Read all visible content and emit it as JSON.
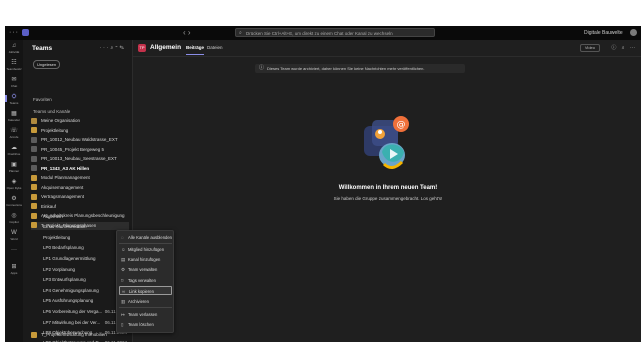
{
  "titlebar": {
    "search_placeholder": "Drücken Sie Ctrl+Alt+E, um direkt zu einem Chat oder Kanal zu wechseln",
    "org_name": "Digitale Bauwelte"
  },
  "rail": [
    {
      "label": "Aktivität",
      "icon": "bell-icon"
    },
    {
      "label": "Teambesitz",
      "icon": "people-icon"
    },
    {
      "label": "Chat",
      "icon": "chat-icon"
    },
    {
      "label": "Teams",
      "icon": "teams-icon",
      "active": true
    },
    {
      "label": "Kalender",
      "icon": "calendar-icon"
    },
    {
      "label": "Anrufe",
      "icon": "phone-icon"
    },
    {
      "label": "OneDrive",
      "icon": "cloud-icon"
    },
    {
      "label": "Planner",
      "icon": "planner-icon"
    },
    {
      "label": "Open Dyks",
      "icon": "app-icon"
    },
    {
      "label": "Connectora",
      "icon": "connector-icon"
    },
    {
      "label": "Copilot",
      "icon": "copilot-icon"
    },
    {
      "label": "Word",
      "icon": "word-icon"
    },
    {
      "label": "",
      "icon": "more-icon"
    },
    {
      "label": "Apps",
      "icon": "apps-icon"
    }
  ],
  "sidebar": {
    "title": "Teams",
    "filter_pill": "Ungelesen",
    "section_favorites": "Favoriten",
    "section_teams": "Teams und Kanäle",
    "teams": [
      {
        "name": "Meine Organisation",
        "color": "#b08a3e"
      },
      {
        "name": "Projektleitung",
        "color": "#c79a3a"
      },
      {
        "name": "PR_10012_Neubau Waldstrasse_EXT",
        "color": "#5c5c5c"
      },
      {
        "name": "PR_10045_Projekt Bergeweg 5",
        "color": "#5c5c5c"
      },
      {
        "name": "PR_10013_Neubau_Seestrasse_EXT",
        "color": "#5c5c5c"
      },
      {
        "name": "PR_1343_A3 AK Hillen",
        "color": "#5c5c5c",
        "bold": true
      },
      {
        "name": "Modul Planmanagement",
        "color": "#c79a3a"
      },
      {
        "name": "Akquisemanagement",
        "color": "#c79a3a"
      },
      {
        "name": "Vertragsmanagement",
        "color": "#c79a3a"
      },
      {
        "name": "Einkauf",
        "color": "#c79a3a"
      },
      {
        "name": "AK_Arbeitskreis Planungsbeschleunigung",
        "color": "#c79a3a"
      },
      {
        "name": "T_Projekt_Planungsphasen",
        "color": "#c79a3a",
        "highlight": true
      }
    ],
    "channels": [
      {
        "name": "Allgemein",
        "date": ""
      },
      {
        "name": "Email Kommunikation",
        "date": ""
      },
      {
        "name": "Projektleitung",
        "date": ""
      },
      {
        "name": "LP0 Bedarfsplanung",
        "date": ""
      },
      {
        "name": "LP1 Grundlagenermittlung",
        "date": ""
      },
      {
        "name": "LP2 Vorplanung",
        "date": ""
      },
      {
        "name": "LP3 Entwurfsplanung",
        "date": ""
      },
      {
        "name": "LP4 Genehmigungsplanung",
        "date": ""
      },
      {
        "name": "LP5 Ausführungsplanung",
        "date": ""
      },
      {
        "name": "LP6 Vorbereitung der Verga...",
        "date": "06.11.2024"
      },
      {
        "name": "LP7 Mitwirkung bei der Ver...",
        "date": "06.11.2024"
      },
      {
        "name": "LP8 Objektüberwachung",
        "date": "06.11.2024"
      },
      {
        "name": "LP9 Objektbetreuung und D...",
        "date": "06.11.2024"
      }
    ],
    "last_team": {
      "name": "T_Projektentwicklung Immobilien",
      "color": "#c79a3a"
    }
  },
  "channel": {
    "avatar": "TP",
    "title": "Allgemein",
    "tabs": [
      "Beiträge",
      "Dateien"
    ],
    "view_button": "Video",
    "banner": "Dieses Team wurde archiviert, daher können Sie keine Nachrichten mehr veröffentlichen.",
    "welcome_title": "Willkommen in Ihrem neuen Team!",
    "welcome_sub": "Sie haben die Gruppe zusammengebracht. Los geht's!"
  },
  "context_menu": [
    {
      "label": "Alle Kanäle ausblenden",
      "icon": "eye-off-icon"
    },
    {
      "label": "Mitglied hinzufügen",
      "icon": "person-add-icon"
    },
    {
      "label": "Kanal hinzufügen",
      "icon": "channel-add-icon"
    },
    {
      "label": "Team verwalten",
      "icon": "settings-icon"
    },
    {
      "label": "Tags verwalten",
      "icon": "tag-icon"
    },
    {
      "label": "Link kopieren",
      "icon": "link-icon",
      "selected": true
    },
    {
      "label": "Archivieren",
      "icon": "archive-icon"
    },
    {
      "label": "Team verlassen",
      "icon": "leave-icon"
    },
    {
      "label": "Team löschen",
      "icon": "trash-icon"
    }
  ]
}
